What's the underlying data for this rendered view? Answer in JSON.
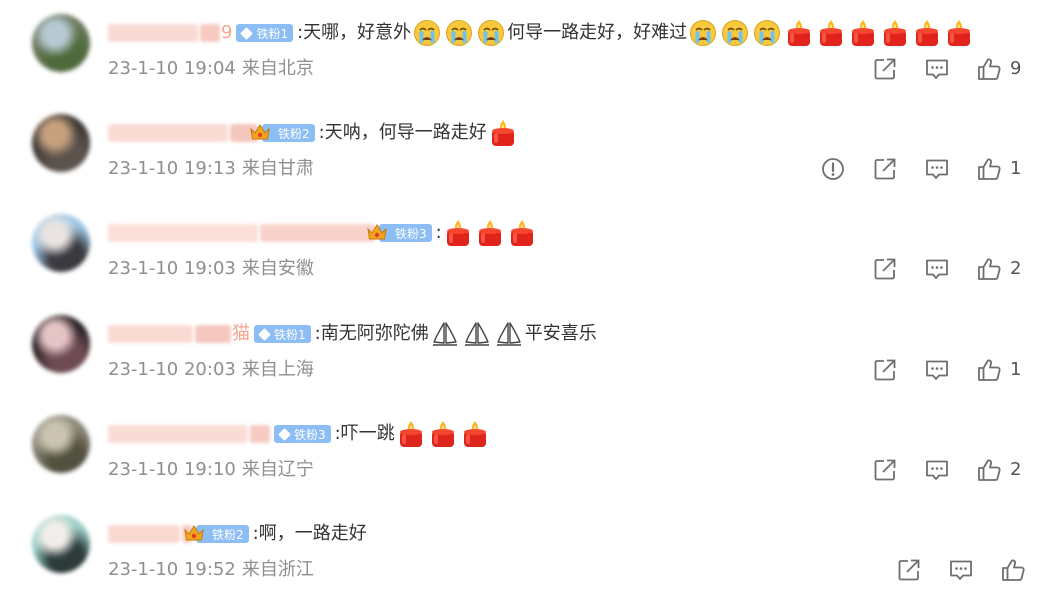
{
  "comments": [
    {
      "username_tail": "9",
      "badge": {
        "label": "铁粉1",
        "kind": "gem"
      },
      "text_segments": [
        ":天哪，好意外",
        "EMO:cry",
        "EMO:cry",
        "EMO:cry",
        "何导一路走好，好难过",
        "EMO:cry",
        "EMO:cry",
        "EMO:cry",
        "EMO:candle",
        "EMO:candle",
        "EMO:candle",
        "EMO:candle",
        "EMO:candle",
        "EMO:candle"
      ],
      "timestamp": "23-1-10 19:04",
      "location": "来自北京",
      "likes": "9",
      "report": false,
      "avatar_colors": [
        "#6b7a5a",
        "#b8c9d4",
        "#4f6a3c"
      ]
    },
    {
      "username_tail": "",
      "badge": {
        "label": "铁粉2",
        "kind": "crown"
      },
      "text_segments": [
        ":天呐，何导一路走好",
        "EMO:candle"
      ],
      "timestamp": "23-1-10 19:13",
      "location": "来自甘肃",
      "likes": "1",
      "report": true,
      "avatar_colors": [
        "#3e3a36",
        "#c7a07e",
        "#5b534c"
      ]
    },
    {
      "username_tail": "",
      "badge": {
        "label": "铁粉3",
        "kind": "crown"
      },
      "text_segments": [
        ":",
        "EMO:candle",
        "EMO:candle",
        "EMO:candle"
      ],
      "timestamp": "23-1-10 19:03",
      "location": "来自安徽",
      "likes": "2",
      "report": false,
      "avatar_colors": [
        "#9cc7e6",
        "#e9e3e2",
        "#3b3a40"
      ]
    },
    {
      "username_tail": "猫",
      "badge": {
        "label": "铁粉1",
        "kind": "gem"
      },
      "text_segments": [
        ":南无阿弥陀佛",
        "EMO:pray",
        "EMO:pray",
        "EMO:pray",
        "平安喜乐"
      ],
      "timestamp": "23-1-10 20:03",
      "location": "来自上海",
      "likes": "1",
      "report": false,
      "avatar_colors": [
        "#2b2426",
        "#e6c4c6",
        "#6e4b52"
      ]
    },
    {
      "username_tail": "",
      "badge": {
        "label": "铁粉3",
        "kind": "gem"
      },
      "text_segments": [
        ":吓一跳",
        "EMO:candle",
        "EMO:candle",
        "EMO:candle"
      ],
      "timestamp": "23-1-10 19:10",
      "location": "来自辽宁",
      "likes": "2",
      "report": false,
      "avatar_colors": [
        "#8d8a7a",
        "#c9c3b0",
        "#53503f"
      ]
    },
    {
      "username_tail": "",
      "badge": {
        "label": "铁粉2",
        "kind": "crown"
      },
      "text_segments": [
        ":啊，一路走好"
      ],
      "timestamp": "23-1-10 19:52",
      "location": "来自浙江",
      "likes": "",
      "report": false,
      "avatar_colors": [
        "#9bd0c8",
        "#f1eeea",
        "#2c3b3a"
      ]
    }
  ],
  "colors": {
    "username_blur": "#f7c9bf",
    "badge_bg": "#8cbdf5",
    "meta_text": "#8f8f8f",
    "icon_stroke": "#6f6f6f"
  },
  "icons": {
    "share": "share-icon",
    "comment": "comment-icon",
    "like": "like-icon",
    "report": "report-icon"
  }
}
